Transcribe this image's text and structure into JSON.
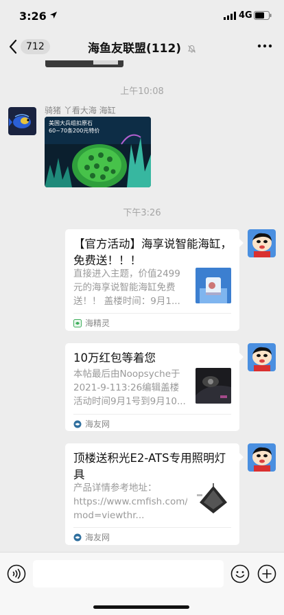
{
  "status_bar": {
    "time": "3:26",
    "network": "4G"
  },
  "nav": {
    "unread_count": "712",
    "title": "海鱼友联盟(112)"
  },
  "timestamps": {
    "first": "上午10:08",
    "second": "下午3:26"
  },
  "image_message": {
    "sender": "骑猪 丫看大海 海缸",
    "caption_line1": "美国大兵组扣原石",
    "caption_line2": "60~70条200元特价"
  },
  "cards": [
    {
      "title": "【官方活动】海享说智能海缸，免费送！！！",
      "description": "直接进入主题，价值2499元的海享说智能海缸免费送！！ 盖楼时间：9月1...",
      "source": "海精灵"
    },
    {
      "title": "10万红包等着您",
      "description": "本帖最后由Noopsyche于 2021-9-113:26编辑盖楼活动时间9月1号到9月10...",
      "source": "海友网"
    },
    {
      "title": "顶楼送积光E2-ATS专用照明灯具",
      "description": "产品详情参考地址：https://www.cmfish.com/bbs/forum.php?mod=viewthr...",
      "source": "海友网"
    }
  ],
  "colors": {
    "background": "#ededed",
    "card": "#ffffff",
    "source_green": "#3fae5c"
  },
  "icons": {
    "status": [
      "location-arrow-icon",
      "signal-icon",
      "battery-icon"
    ],
    "nav": [
      "back-chevron-icon",
      "mute-icon",
      "more-icon"
    ],
    "input": [
      "voice-icon",
      "emoji-icon",
      "plus-icon"
    ]
  }
}
